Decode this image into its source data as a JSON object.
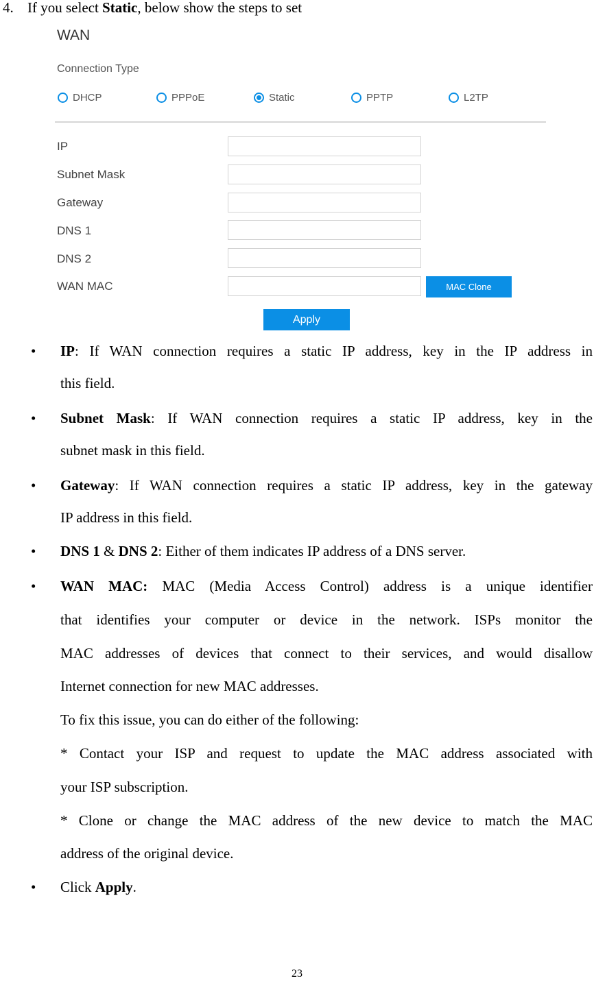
{
  "heading": {
    "number": "4.",
    "prefix": "If you select ",
    "bold": "Static",
    "suffix": ", below show the steps to set"
  },
  "wan_panel": {
    "title": "WAN",
    "connection_type_label": "Connection Type",
    "radio_options": [
      {
        "label": "DHCP",
        "selected": false
      },
      {
        "label": "PPPoE",
        "selected": false
      },
      {
        "label": "Static",
        "selected": true
      },
      {
        "label": "PPTP",
        "selected": false
      },
      {
        "label": "L2TP",
        "selected": false
      }
    ],
    "fields": [
      {
        "label": "IP",
        "value": ""
      },
      {
        "label": "Subnet Mask",
        "value": ""
      },
      {
        "label": "Gateway",
        "value": ""
      },
      {
        "label": "DNS 1",
        "value": ""
      },
      {
        "label": "DNS 2",
        "value": ""
      },
      {
        "label": "WAN MAC",
        "value": ""
      }
    ],
    "mac_clone_button": "MAC Clone",
    "apply_button": "Apply",
    "accent_color": "#0b8fe5"
  },
  "bullets": {
    "symbol": "•",
    "ip": {
      "term": "IP",
      "line1": ": If WAN connection requires a static IP address, key in the IP address in",
      "line2": "this field."
    },
    "subnet": {
      "term": "Subnet Mask",
      "line1": ": If WAN connection requires a static IP address, key in the",
      "line2": "subnet mask in this field."
    },
    "gateway": {
      "term": "Gateway",
      "line1": ": If WAN connection requires a static IP address, key in the gateway",
      "line2": "IP address in this field."
    },
    "dns": {
      "term1": "DNS 1",
      "amp": " & ",
      "term2": "DNS 2",
      "line1": ": Either of them indicates IP address of a DNS server."
    },
    "wanmac": {
      "term": "WAN MAC:",
      "line1": " MAC (Media Access Control) address is a unique identifier",
      "line2": "that identifies your computer or device in the network. ISPs monitor the",
      "line3": "MAC addresses of devices that connect to their services, and would disallow",
      "line4": "Internet connection for new MAC addresses.",
      "line5": "To fix this issue, you can do either of the following:",
      "line6": "* Contact your ISP and request to update the MAC address associated with",
      "line7": "your ISP subscription.",
      "line8": "* Clone or change the MAC address of the new device to match the MAC",
      "line9": "address of the original device."
    },
    "apply": {
      "prefix": "Click ",
      "term": "Apply",
      "suffix": "."
    }
  },
  "page_number": "23"
}
